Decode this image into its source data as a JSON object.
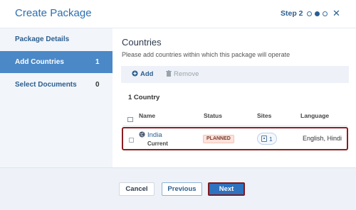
{
  "dialog": {
    "title": "Create Package",
    "step_label": "Step 2",
    "steps_total": 3,
    "step_current": 2,
    "close_glyph": "✕"
  },
  "sidebar": {
    "items": [
      {
        "label": "Package Details",
        "count": "",
        "active": false
      },
      {
        "label": "Add Countries",
        "count": "1",
        "active": true
      },
      {
        "label": "Select Documents",
        "count": "0",
        "active": false
      }
    ]
  },
  "main": {
    "section_title": "Countries",
    "instructions": "Please add countries within which this package will operate",
    "toolbar": {
      "add_label": "Add",
      "add_icon": "plus-circle-icon",
      "remove_label": "Remove",
      "remove_icon": "trash-icon"
    },
    "count_label": "1 Country",
    "table": {
      "headers": {
        "name": "Name",
        "status": "Status",
        "sites": "Sites",
        "language": "Language"
      },
      "rows": [
        {
          "name": "India",
          "sub": "Current",
          "status": "PLANNED",
          "sites": "1",
          "language": "English, Hindi"
        }
      ]
    }
  },
  "footer": {
    "cancel_label": "Cancel",
    "previous_label": "Previous",
    "next_label": "Next"
  },
  "colors": {
    "accent": "#2c6fb0",
    "sidebar_active": "#4a88c7",
    "primary_button": "#2f72bf",
    "highlight_border": "#8b1e24",
    "status_badge_bg": "#fde3dc"
  }
}
